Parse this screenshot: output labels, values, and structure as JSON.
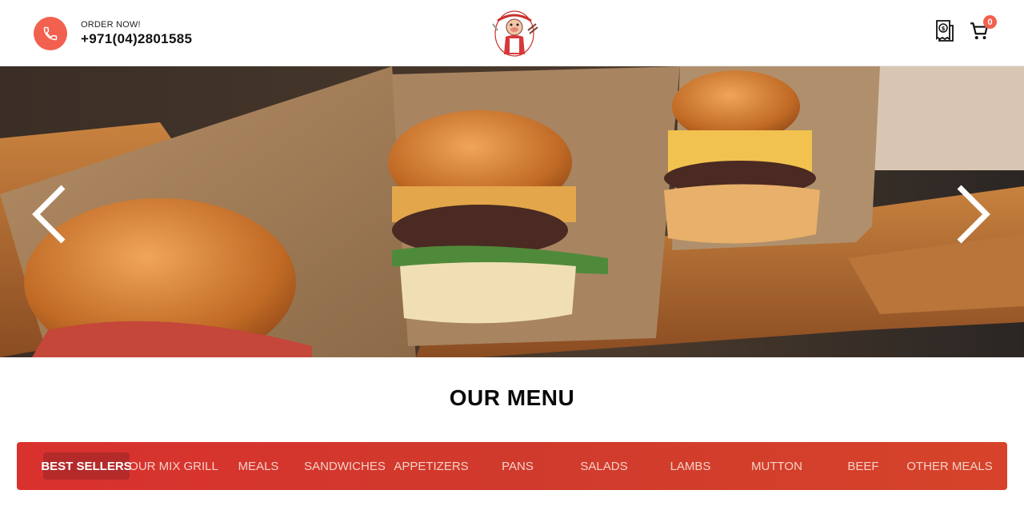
{
  "header": {
    "order_label": "ORDER NOW!",
    "phone": "+971(04)2801585",
    "phone_icon": "phone-icon",
    "receipt_icon": "receipt-dollar-icon",
    "cart_icon": "cart-icon",
    "cart_count": "0",
    "accent_color": "#f2604f"
  },
  "hero": {
    "prev_icon": "chevron-left-icon",
    "next_icon": "chevron-right-icon"
  },
  "menu": {
    "title": "OUR MENU",
    "bar_color": "#d03a2c",
    "active_index": 0,
    "categories": [
      "BEST SELLERS",
      "OUR MIX GRILL",
      "MEALS",
      "SANDWICHES",
      "APPETIZERS",
      "PANS",
      "SALADS",
      "LAMBS",
      "MUTTON",
      "BEEF",
      "OTHER MEALS"
    ]
  }
}
